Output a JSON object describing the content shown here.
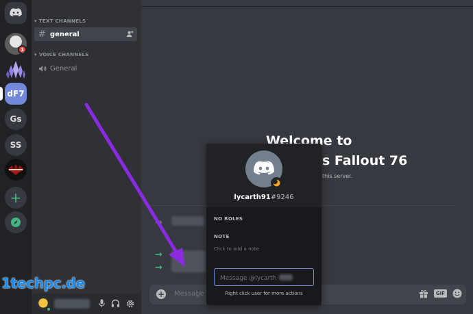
{
  "servers": {
    "items": [
      {
        "name": "home",
        "label": ""
      },
      {
        "name": "server-avatar",
        "label": ""
      },
      {
        "name": "server-crystal",
        "label": ""
      },
      {
        "name": "server-df7",
        "label": "dF7"
      },
      {
        "name": "server-gs",
        "label": "Gs"
      },
      {
        "name": "server-ss",
        "label": "SS"
      },
      {
        "name": "server-wasteland",
        "label": ""
      }
    ],
    "unread_badge": "1"
  },
  "sidebar": {
    "text_category": "TEXT CHANNELS",
    "text_channels": [
      {
        "label": "general"
      }
    ],
    "voice_category": "VOICE CHANNELS",
    "voice_channels": [
      {
        "label": "General"
      }
    ]
  },
  "main": {
    "welcome_line1": "Welcome to",
    "welcome_line2": "s Fallout 76",
    "welcome_line3": "this server.",
    "message_placeholder": "Message #"
  },
  "popout": {
    "username": "lycarth91",
    "discriminator": "#9246",
    "roles_heading": "NO ROLES",
    "note_heading": "NOTE",
    "note_placeholder": "Click to add a note",
    "dm_placeholder": "Message @lycarth",
    "footer_hint": "Right click user for more actions"
  },
  "watermark": "1techpc.de",
  "colors": {
    "blurple": "#7289da",
    "green": "#43b581",
    "red": "#f04747",
    "annotation_purple": "#8a2be2",
    "watermark_blue": "#1e88e5"
  },
  "icons": [
    "discord-logo-icon",
    "add-server-icon",
    "compass-icon",
    "invite-icon",
    "speaker-icon",
    "mic-icon",
    "headphones-icon",
    "gear-icon",
    "gift-icon",
    "gif-icon",
    "emoji-icon",
    "idle-moon-icon"
  ]
}
